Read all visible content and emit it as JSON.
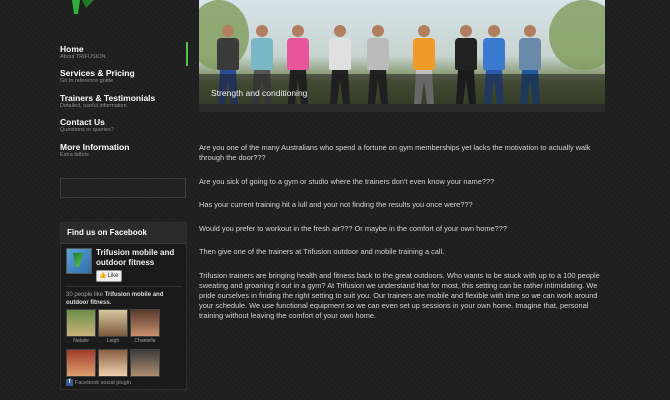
{
  "nav": {
    "items": [
      {
        "label": "Home",
        "sub": "About TRIFUSION"
      },
      {
        "label": "Services & Pricing",
        "sub": "Go to reference guide"
      },
      {
        "label": "Trainers & Testimonials",
        "sub": "Detailed, useful information"
      },
      {
        "label": "Contact Us",
        "sub": "Questions or queries?"
      },
      {
        "label": "More Information",
        "sub": "Extra tidbits"
      }
    ]
  },
  "hero": {
    "caption": "Strength and conditioning"
  },
  "facebook": {
    "header": "Find us on Facebook",
    "page_name": "Trifusion mobile and outdoor fitness",
    "like_label": "Like",
    "fans_prefix": "30 people like",
    "fans_page_name": "Trifusion mobile and outdoor fitness.",
    "fans": [
      {
        "name": "Natalie"
      },
      {
        "name": "Leigh"
      },
      {
        "name": "Chantelle"
      },
      {
        "name": ""
      },
      {
        "name": ""
      },
      {
        "name": ""
      }
    ],
    "footer": "Facebook social plugin"
  },
  "content": {
    "paragraphs": [
      "Are you one of the many Australians who spend a fortune on gym memberships yet lacks the motivation to actually walk through the door???",
      "Are you sick of going to a gym or studio where the trainers don't even know your name???",
      "Has your current training hit a lull and your not finding the results you once were???",
      "Would you prefer to workout in the fresh air??? Or maybe in the comfort of your own home???",
      "Then give one of the trainers at Trifusion outdoor and mobile training a call.",
      "Trifusion trainers are bringing health and fitness back to the great outdoors. Who wants to be stuck with up to a 100 people sweating and groaning it out in a gym? At Trifusion we understand that for most, this setting can be rather intimidating. We pride ourselves in finding the right setting to suit you. Our trainers are mobile and flexible with time so we can work around your schedule. We use functional equipment so we can even set up sessions in your own home. Imagine that, personal training without leaving the comfort of your own home."
    ]
  },
  "colors": {
    "accent": "#4fc24f",
    "background": "#1e1e1e",
    "facebook_blue": "#3b5998"
  }
}
